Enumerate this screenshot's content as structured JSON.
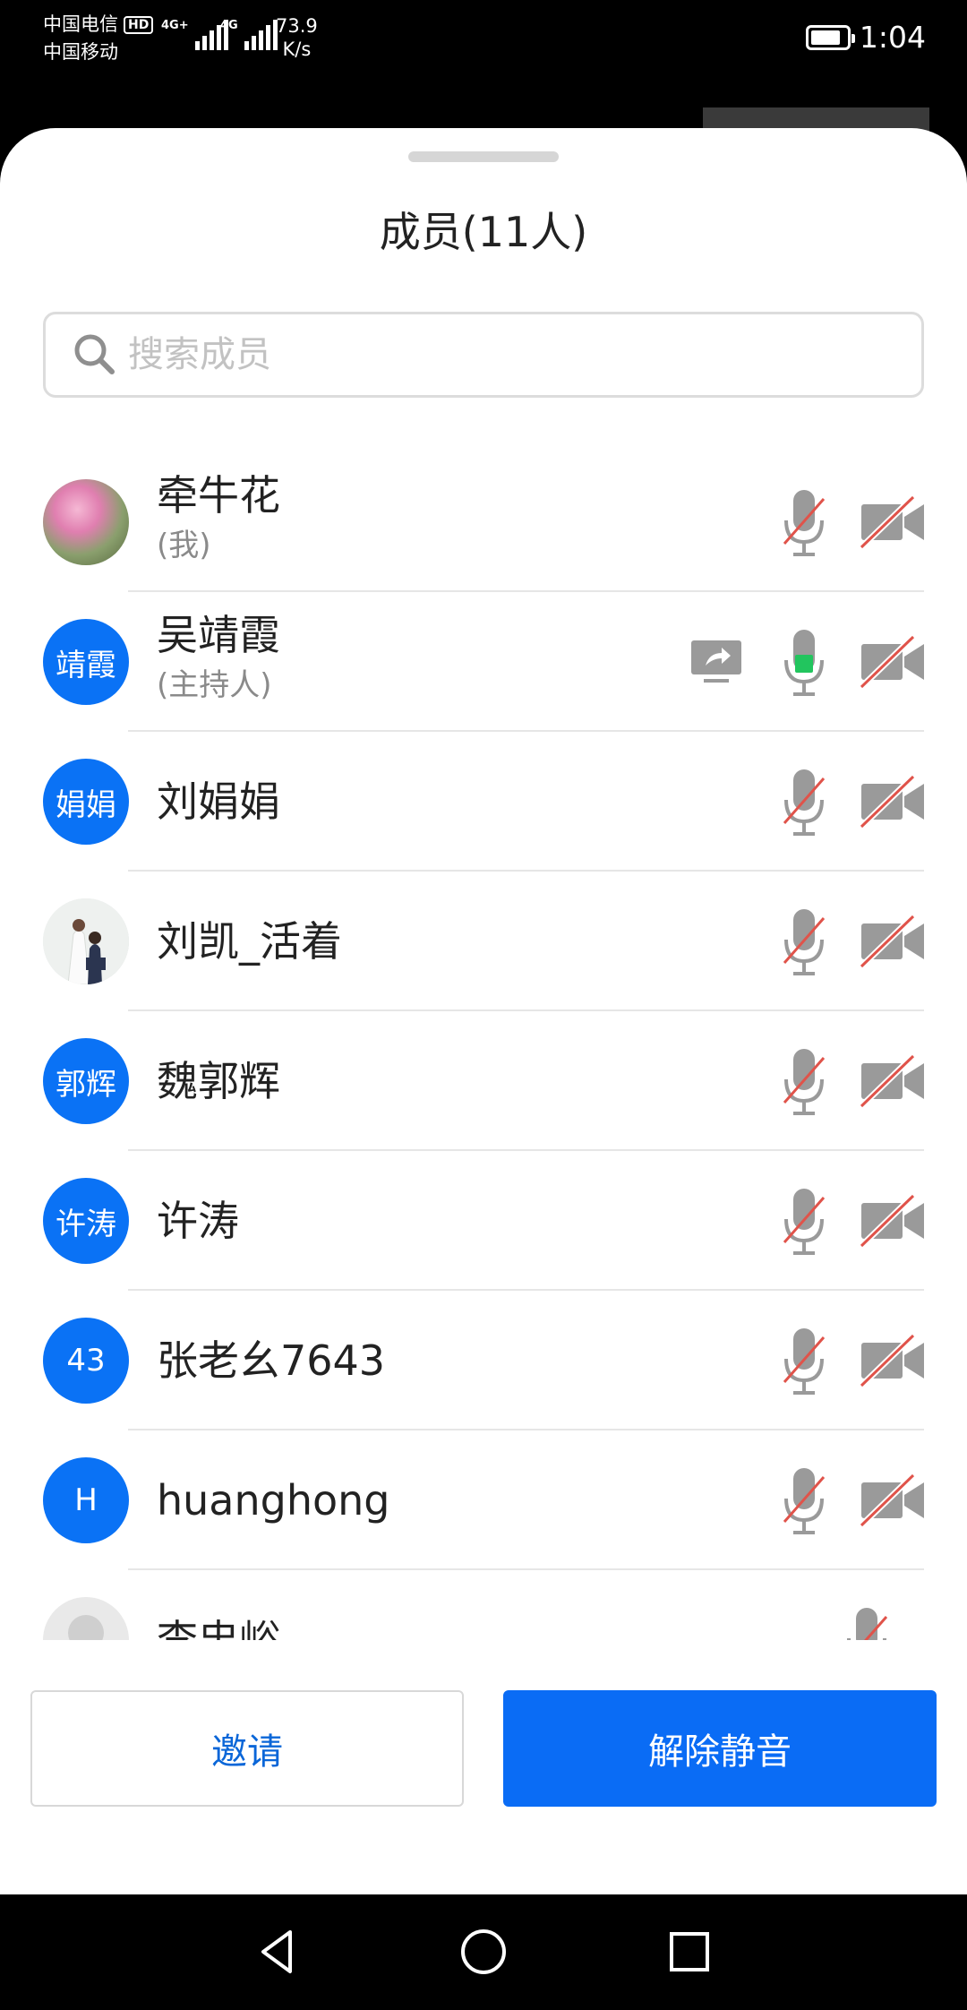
{
  "status_bar": {
    "carrier_1": "中国电信",
    "carrier_1_badge": "HD",
    "carrier_2": "中国移动",
    "network_1": "4G+",
    "network_2": "4G",
    "net_speed_value": "73.9",
    "net_speed_unit": "K/s",
    "battery_level": 0.85,
    "time": "1:04"
  },
  "sheet": {
    "title": "成员(11人)"
  },
  "search": {
    "placeholder": "搜索成员",
    "icon": "search-icon"
  },
  "members": [
    {
      "name": "牵牛花",
      "role": "(我)",
      "avatar": "photo-flower",
      "mic": "muted",
      "camera": "off",
      "sharing": false
    },
    {
      "name": "吴靖霞",
      "role": "(主持人)",
      "avatar_text": "靖霞",
      "avatar": "blue",
      "mic": "active",
      "camera": "off",
      "sharing": true
    },
    {
      "name": "刘娟娟",
      "role": "",
      "avatar_text": "娟娟",
      "avatar": "blue",
      "mic": "muted",
      "camera": "off",
      "sharing": false
    },
    {
      "name": "刘凯_活着",
      "role": "",
      "avatar": "photo-couple",
      "mic": "muted",
      "camera": "off",
      "sharing": false
    },
    {
      "name": "魏郭辉",
      "role": "",
      "avatar_text": "郭辉",
      "avatar": "blue",
      "mic": "muted",
      "camera": "off",
      "sharing": false
    },
    {
      "name": "许涛",
      "role": "",
      "avatar_text": "许涛",
      "avatar": "blue",
      "mic": "muted",
      "camera": "off",
      "sharing": false
    },
    {
      "name": "张老幺7643",
      "role": "",
      "avatar_text": "43",
      "avatar": "blue",
      "mic": "muted",
      "camera": "off",
      "sharing": false
    },
    {
      "name": "huanghong",
      "role": "",
      "avatar_text": "H",
      "avatar": "blue",
      "mic": "muted",
      "camera": "off",
      "sharing": false
    },
    {
      "name": "李忠峪",
      "role": "",
      "avatar": "placeholder",
      "mic": "muted",
      "camera": "none",
      "sharing": false
    }
  ],
  "actions": {
    "invite_label": "邀请",
    "unmute_label": "解除静音"
  },
  "colors": {
    "accent_blue": "#0a6cf5",
    "mic_active": "#22c55e",
    "muted_slash": "#e0534a",
    "icon_gray": "#9a9a9a"
  },
  "nav": {
    "back": "back-icon",
    "home": "home-icon",
    "recents": "recents-icon"
  }
}
